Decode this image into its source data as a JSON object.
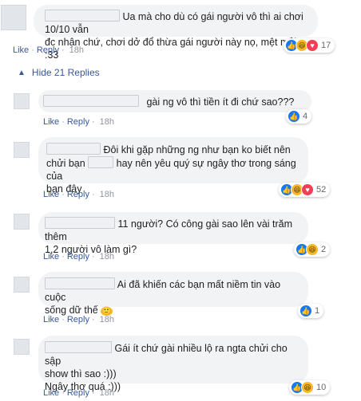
{
  "labels": {
    "like": "Like",
    "reply": "Reply",
    "sep": "·"
  },
  "hide_replies": "Hide 21 Replies",
  "comments": [
    {
      "text_1": "Ua mà cho dù có gái người vô thì ai chơi 10/10 vẫn",
      "text_2": "đc nhận chứ, chơi dở đổ thừa gái người này nọ, mệt mỏi :33",
      "time": "18h",
      "count": "17"
    },
    {
      "text_1": "gài ng vô thì tiền ít đi chứ sao???",
      "time": "18h",
      "count": "4"
    },
    {
      "text_1": "Đôi khi gặp những ng như bạn ko biết nên",
      "text_2a": "chửi bạn",
      "text_2b": "hay nên yêu quý sự ngây thơ trong sáng của",
      "text_3": "bạn đây",
      "time": "18h",
      "count": "52"
    },
    {
      "text_1": "11 người? Có công gài sao lên vài trăm thêm",
      "text_2": "1,2 người vô làm gì?",
      "time": "18h",
      "count": "2"
    },
    {
      "text_1": "Ai đã khiến các bạn mất niềm tin vào cuộc",
      "text_2": "sống dữ thế",
      "emoji": "🙂",
      "time": "18h",
      "count": "1"
    },
    {
      "text_1": "Gái ít chứ gài nhiều lộ ra ngta chửi cho sập",
      "text_2": "show thì sao :)))",
      "text_3": "Ngây thơ quá :)))",
      "time": "18h",
      "count": "10"
    }
  ],
  "icons": {
    "like": "thumbs-up-icon",
    "haha": "haha-icon",
    "love": "heart-icon",
    "collapse": "caret-up-icon"
  }
}
